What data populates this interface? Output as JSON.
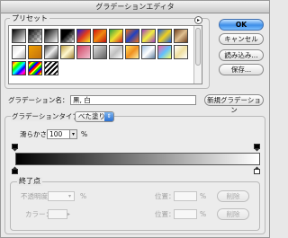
{
  "window": {
    "title": "グラデーションエディタ"
  },
  "presets": {
    "label": "プリセット",
    "menu_icon": "circle-arrow-icon"
  },
  "buttons": {
    "ok": "OK",
    "cancel": "キャンセル",
    "load": "読み込み...",
    "save": "保存...",
    "new_gradient": "新規グラデーション",
    "delete_opacity": "削除",
    "delete_color": "削除"
  },
  "name": {
    "label": "グラデーション名：",
    "value": "黒, 白"
  },
  "gradient_type": {
    "label": "グラデーションタイプ：",
    "value": "べた塗り"
  },
  "smoothness": {
    "label": "滑らかさ：",
    "value": "100",
    "unit": "%"
  },
  "stops": {
    "legend": "終了点",
    "opacity_label": "不透明度：",
    "opacity_unit": "%",
    "location_label_1": "位置：",
    "location_unit_1": "%",
    "color_label": "カラー：",
    "location_label_2": "位置：",
    "location_unit_2": "%"
  },
  "colors": {
    "accent": "#3c8ee8"
  }
}
